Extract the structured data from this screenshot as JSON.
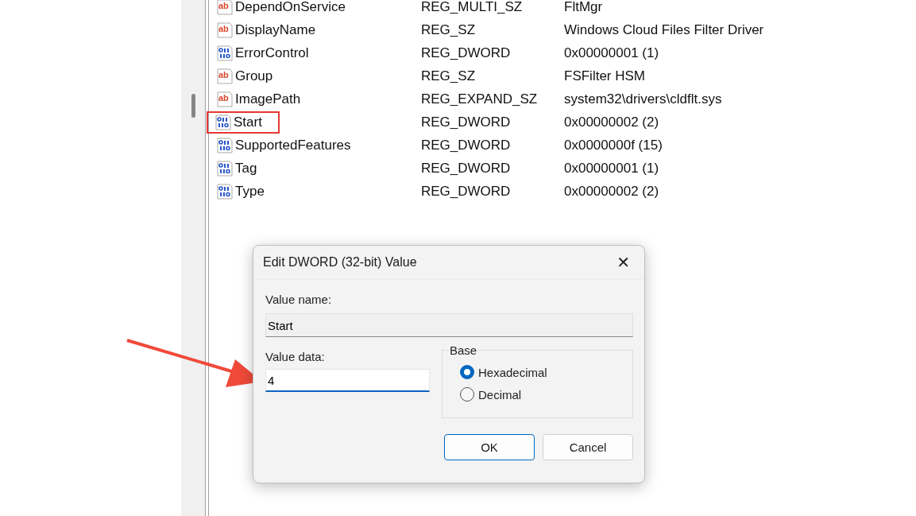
{
  "values": [
    {
      "kind": "string",
      "icon_text": "ab",
      "name": "DependOnService",
      "type": "REG_MULTI_SZ",
      "data": "FltMgr",
      "highlighted": false
    },
    {
      "kind": "string",
      "icon_text": "ab",
      "name": "DisplayName",
      "type": "REG_SZ",
      "data": "Windows Cloud Files Filter Driver",
      "highlighted": false
    },
    {
      "kind": "dword",
      "name": "ErrorControl",
      "type": "REG_DWORD",
      "data": "0x00000001 (1)",
      "highlighted": false
    },
    {
      "kind": "string",
      "icon_text": "ab",
      "name": "Group",
      "type": "REG_SZ",
      "data": "FSFilter HSM",
      "highlighted": false
    },
    {
      "kind": "string",
      "icon_text": "ab",
      "name": "ImagePath",
      "type": "REG_EXPAND_SZ",
      "data": "system32\\drivers\\cldflt.sys",
      "highlighted": false
    },
    {
      "kind": "dword",
      "name": "Start",
      "type": "REG_DWORD",
      "data": "0x00000002 (2)",
      "highlighted": true
    },
    {
      "kind": "dword",
      "name": "SupportedFeatures",
      "type": "REG_DWORD",
      "data": "0x0000000f (15)",
      "highlighted": false
    },
    {
      "kind": "dword",
      "name": "Tag",
      "type": "REG_DWORD",
      "data": "0x00000001 (1)",
      "highlighted": false
    },
    {
      "kind": "dword",
      "name": "Type",
      "type": "REG_DWORD",
      "data": "0x00000002 (2)",
      "highlighted": false
    }
  ],
  "dialog": {
    "title": "Edit DWORD (32-bit) Value",
    "close": "✕",
    "name_label": "Value name:",
    "name_value": "Start",
    "data_label": "Value data:",
    "data_value": "4",
    "base_label": "Base",
    "bases": [
      {
        "label": "Hexadecimal",
        "selected": true
      },
      {
        "label": "Decimal",
        "selected": false
      }
    ],
    "buttons": [
      {
        "label": "OK",
        "default": true
      },
      {
        "label": "Cancel",
        "default": false
      }
    ]
  }
}
